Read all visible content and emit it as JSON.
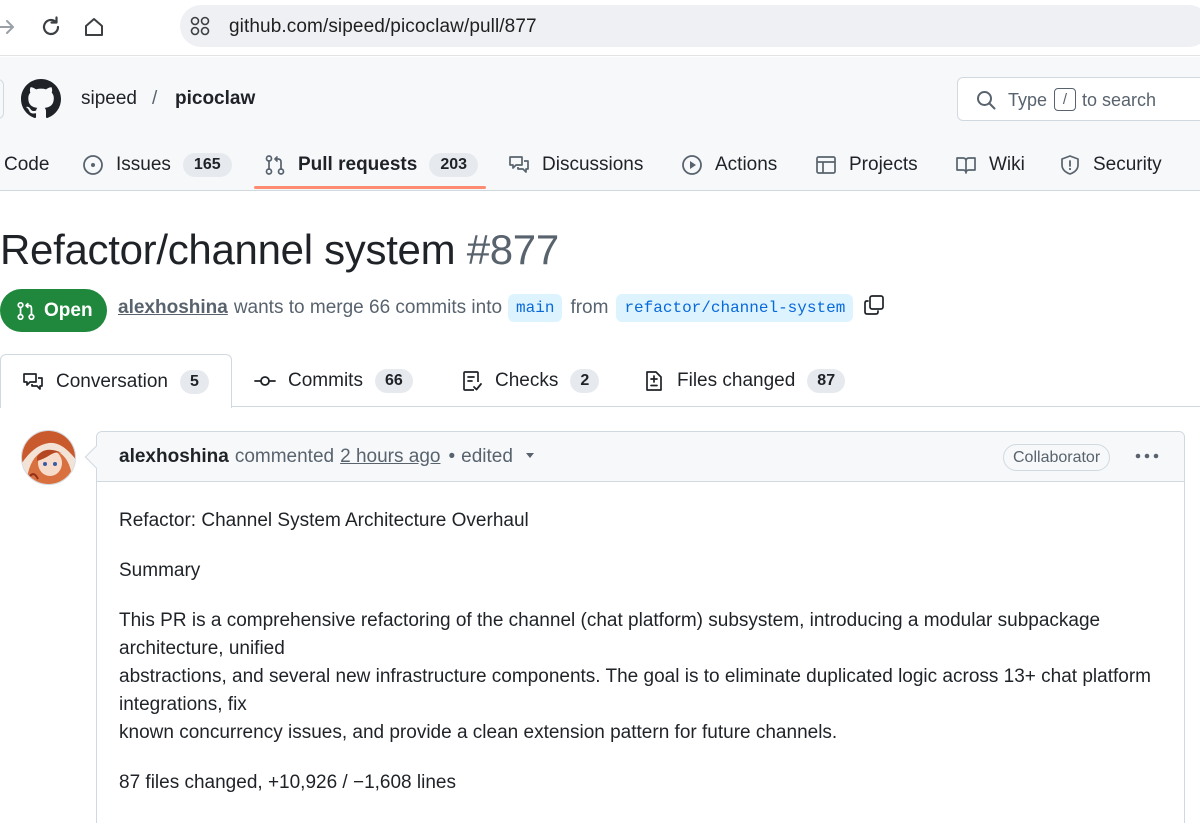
{
  "browser": {
    "url": "github.com/sipeed/picoclaw/pull/877"
  },
  "header": {
    "owner": "sipeed",
    "separator": "/",
    "repo": "picoclaw",
    "search": {
      "prefix": "Type",
      "key": "/",
      "suffix": "to search"
    }
  },
  "repo_tabs": [
    {
      "label": "Code",
      "icon": "code-icon",
      "count": ""
    },
    {
      "label": "Issues",
      "icon": "issue-icon",
      "count": "165"
    },
    {
      "label": "Pull requests",
      "icon": "pull-request-icon",
      "count": "203",
      "active": true
    },
    {
      "label": "Discussions",
      "icon": "discussion-icon",
      "count": ""
    },
    {
      "label": "Actions",
      "icon": "play-icon",
      "count": ""
    },
    {
      "label": "Projects",
      "icon": "table-icon",
      "count": ""
    },
    {
      "label": "Wiki",
      "icon": "book-icon",
      "count": ""
    },
    {
      "label": "Security",
      "icon": "shield-icon",
      "count": ""
    }
  ],
  "pr": {
    "title": "Refactor/channel system",
    "number": "#877",
    "state": "Open",
    "author": "alexhoshina",
    "summary_text": "wants to merge 66 commits into",
    "base_branch": "main",
    "from_text": "from",
    "head_branch": "refactor/channel-system"
  },
  "pr_tabs": [
    {
      "label": "Conversation",
      "icon": "comment-discussion-icon",
      "count": "5",
      "active": true
    },
    {
      "label": "Commits",
      "icon": "commit-icon",
      "count": "66"
    },
    {
      "label": "Checks",
      "icon": "checklist-icon",
      "count": "2"
    },
    {
      "label": "Files changed",
      "icon": "file-diff-icon",
      "count": "87"
    }
  ],
  "comment": {
    "author": "alexhoshina",
    "action": "commented",
    "time": "2 hours ago",
    "dot": "•",
    "edited": "edited",
    "role": "Collaborator",
    "paragraphs": [
      "Refactor: Channel System Architecture Overhaul",
      "Summary",
      "This PR is a comprehensive refactoring of the channel (chat platform) subsystem, introducing a modular subpackage architecture, unified\nabstractions, and several new infrastructure components. The goal is to eliminate duplicated logic across 13+ chat platform integrations, fix\nknown concurrency issues, and provide a clean extension pattern for future channels.",
      "87 files changed, +10,926 / −1,608 lines"
    ]
  }
}
